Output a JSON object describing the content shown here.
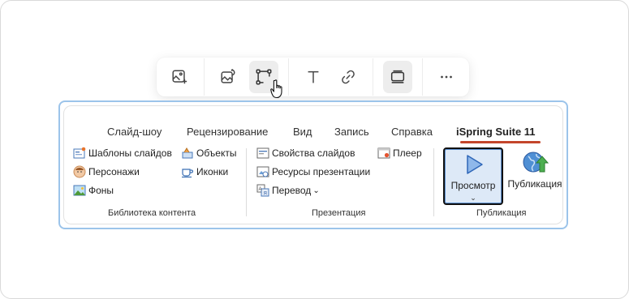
{
  "toolbar": {
    "buttons": [
      {
        "icon": "add-image-icon"
      },
      {
        "icon": "image-edit-icon"
      },
      {
        "icon": "shape-edit-icon",
        "active": true
      },
      {
        "icon": "text-icon"
      },
      {
        "icon": "link-icon"
      },
      {
        "icon": "layout-icon",
        "active": true
      },
      {
        "icon": "more-icon"
      }
    ]
  },
  "ribbon": {
    "tabs": [
      "Слайд-шоу",
      "Рецензирование",
      "Вид",
      "Запись",
      "Справка",
      "iSpring Suite 11"
    ],
    "active_tab": "iSpring Suite 11",
    "accent_color": "#c4462b",
    "groups": {
      "content_library": {
        "label": "Библиотека контента",
        "items": [
          "Шаблоны слайдов",
          "Объекты",
          "Персонажи",
          "Иконки",
          "Фоны"
        ]
      },
      "presentation": {
        "label": "Презентация",
        "items": [
          "Свойства слайдов",
          "Плеер",
          "Ресурсы презентации",
          "Перевод"
        ]
      },
      "publishing": {
        "label": "Публикация",
        "preview": "Просмотр",
        "preview_chevron": "⌄",
        "publish": "Публикация"
      }
    }
  }
}
